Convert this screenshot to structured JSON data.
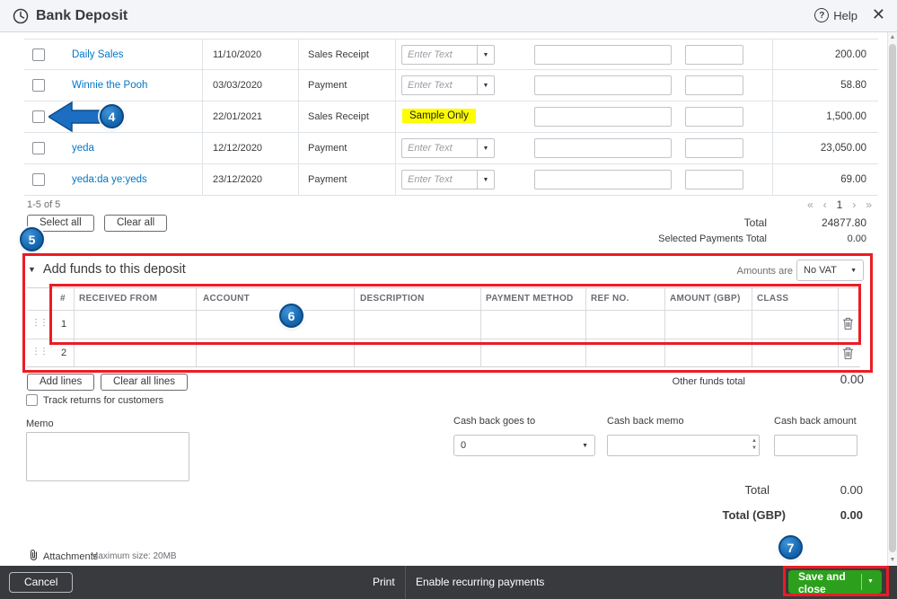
{
  "header": {
    "title": "Bank Deposit",
    "help": "Help",
    "close": "✕"
  },
  "payments": {
    "rows": [
      {
        "name": "Daily Sales",
        "date": "11/10/2020",
        "type": "Sales Receipt",
        "method_placeholder": "Enter Text",
        "amount": "200.00"
      },
      {
        "name": "Winnie the Pooh",
        "date": "03/03/2020",
        "type": "Payment",
        "method_placeholder": "Enter Text",
        "amount": "58.80"
      },
      {
        "name": "",
        "date": "22/01/2021",
        "type": "Sales Receipt",
        "method_text": "Sample Only",
        "amount": "1,500.00"
      },
      {
        "name": "yeda",
        "date": "12/12/2020",
        "type": "Payment",
        "method_placeholder": "Enter Text",
        "amount": "23,050.00"
      },
      {
        "name": "yeda:da ye:yeds",
        "date": "23/12/2020",
        "type": "Payment",
        "method_placeholder": "Enter Text",
        "amount": "69.00"
      }
    ],
    "range": "1-5 of 5",
    "pager": {
      "first": "«",
      "prev": "‹",
      "page": "1",
      "next": "›",
      "last": "»"
    },
    "select_all": "Select all",
    "clear_all": "Clear all",
    "total_label": "Total",
    "total_value": "24877.80",
    "selected_total_label": "Selected Payments Total",
    "selected_total_value": "0.00"
  },
  "add_funds": {
    "title": "Add funds to this deposit",
    "amounts_are_label": "Amounts are",
    "amounts_are_value": "No VAT",
    "columns": [
      "#",
      "RECEIVED FROM",
      "ACCOUNT",
      "DESCRIPTION",
      "PAYMENT METHOD",
      "REF NO.",
      "AMOUNT (GBP)",
      "CLASS"
    ],
    "row_numbers": [
      "1",
      "2"
    ],
    "add_lines": "Add lines",
    "clear_all_lines": "Clear all lines",
    "other_funds_label": "Other funds total",
    "other_funds_value": "0.00"
  },
  "options": {
    "track_returns": "Track returns for customers"
  },
  "memo": {
    "label": "Memo"
  },
  "cash_back": {
    "goes_to_label": "Cash back goes to",
    "goes_to_value": "0",
    "memo_label": "Cash back memo",
    "amount_label": "Cash back amount"
  },
  "totals": {
    "total_label": "Total",
    "total_value": "0.00",
    "total_gbp_label": "Total (GBP)",
    "total_gbp_value": "0.00"
  },
  "attachments": {
    "label": "Attachments",
    "note": "Maximum size: 20MB"
  },
  "footer": {
    "cancel": "Cancel",
    "print": "Print",
    "recurring": "Enable recurring payments",
    "save_and_close": "Save and close"
  },
  "annotations": {
    "step4": "4",
    "step5": "5",
    "step6": "6",
    "step7": "7"
  }
}
